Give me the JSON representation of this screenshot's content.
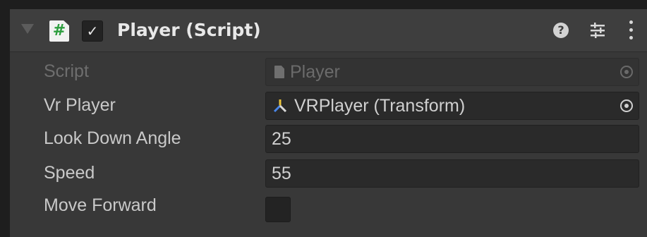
{
  "component": {
    "title": "Player (Script)",
    "enabled": true,
    "icons": {
      "foldout": "foldout-arrow-icon",
      "script": "csharp-script-icon",
      "help": "help-icon",
      "presets": "presets-sliders-icon",
      "menu": "kebab-menu-icon"
    }
  },
  "help_glyph": "?",
  "check_glyph": "✓",
  "script_glyph": "#",
  "fields": {
    "script": {
      "label": "Script",
      "value": "Player"
    },
    "vr_player": {
      "label": "Vr Player",
      "value": "VRPlayer (Transform)"
    },
    "look_down_angle": {
      "label": "Look Down Angle",
      "value": "25"
    },
    "speed": {
      "label": "Speed",
      "value": "55"
    },
    "move_forward": {
      "label": "Move Forward",
      "value": false
    }
  },
  "colors": {
    "panel_bg": "#383838",
    "header_bg": "#3e3e3e",
    "field_bg": "#2a2a2a",
    "script_icon_accent": "#2e9e3f"
  }
}
